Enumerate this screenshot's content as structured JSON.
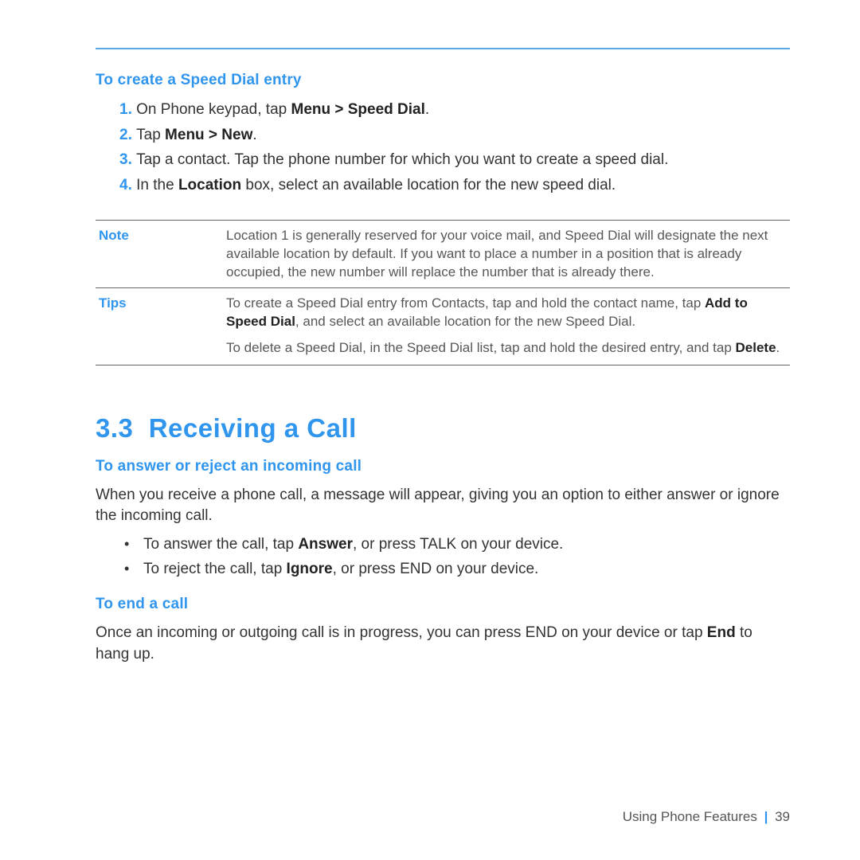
{
  "section1": {
    "heading": "To create a Speed Dial entry",
    "steps": [
      {
        "num": "1.",
        "parts": [
          "On Phone keypad, tap ",
          {
            "b": "Menu > Speed Dial"
          },
          "."
        ]
      },
      {
        "num": "2.",
        "parts": [
          "Tap ",
          {
            "b": "Menu > New"
          },
          "."
        ]
      },
      {
        "num": "3.",
        "parts": [
          "Tap a contact. Tap the phone number for which you want to create a speed dial."
        ]
      },
      {
        "num": "4.",
        "parts": [
          "In the ",
          {
            "b": "Location"
          },
          " box, select an available location for the new speed dial."
        ]
      }
    ]
  },
  "note": {
    "label": "Note",
    "text": "Location 1 is generally reserved for your voice mail, and Speed Dial will designate the next available location by default. If you want to place a number in a position that is already occupied, the new number will replace the number that is already there."
  },
  "tips": {
    "label": "Tips",
    "p1_parts": [
      "To create a Speed Dial entry from Contacts, tap and hold the contact name, tap ",
      {
        "b": "Add to Speed Dial"
      },
      ", and select an available location for the new Speed Dial."
    ],
    "p2_parts": [
      "To delete a Speed Dial, in the Speed Dial list, tap and hold the desired entry, and tap ",
      {
        "b": "Delete"
      },
      "."
    ]
  },
  "section2": {
    "number": "3.3",
    "title": "Receiving a Call",
    "sub1": {
      "heading": "To answer or reject an incoming call",
      "intro": "When you receive a phone call, a message will appear, giving you an option to either answer or ignore the incoming call.",
      "bullets": [
        {
          "parts": [
            "To answer the call, tap ",
            {
              "b": "Answer"
            },
            ", or press TALK on your device."
          ]
        },
        {
          "parts": [
            "To reject the call, tap ",
            {
              "b": "Ignore"
            },
            ", or press END on your device."
          ]
        }
      ]
    },
    "sub2": {
      "heading": "To end a call",
      "text_parts": [
        "Once an incoming or outgoing call is in progress, you can press END on your device or tap ",
        {
          "b": "End"
        },
        " to hang up."
      ]
    }
  },
  "footer": {
    "chapter": "Using Phone Features",
    "page": "39"
  }
}
